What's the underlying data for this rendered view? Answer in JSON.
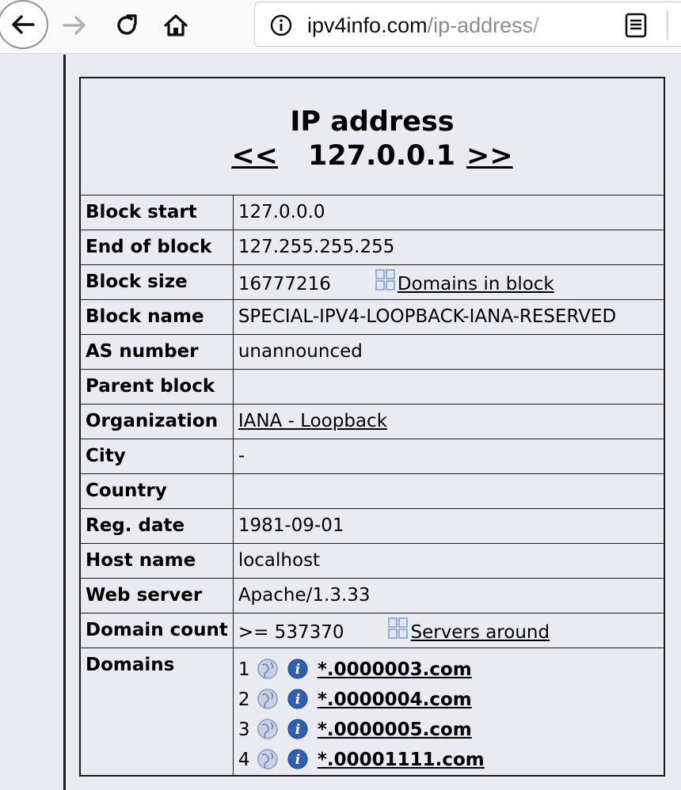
{
  "browser": {
    "url_host": "ipv4info.com",
    "url_path": "/ip-address/"
  },
  "header": {
    "title": "IP address",
    "prev": "<<",
    "ip": "127.0.0.1",
    "next": ">>"
  },
  "rows": {
    "block_start": {
      "label": "Block start",
      "value": "127.0.0.0"
    },
    "end_of_block": {
      "label": "End of block",
      "value": "127.255.255.255"
    },
    "block_size": {
      "label": "Block size",
      "value": "16777216",
      "link": "Domains in block"
    },
    "block_name": {
      "label": "Block name",
      "value": "SPECIAL-IPV4-LOOPBACK-IANA-RESERVED"
    },
    "as_number": {
      "label": "AS number",
      "value": "unannounced"
    },
    "parent_block": {
      "label": "Parent block",
      "value": ""
    },
    "organization": {
      "label": "Organization",
      "value": "IANA - Loopback"
    },
    "city": {
      "label": "City",
      "value": "-"
    },
    "country": {
      "label": "Country",
      "value": ""
    },
    "reg_date": {
      "label": "Reg. date",
      "value": "1981-09-01"
    },
    "host_name": {
      "label": "Host name",
      "value": "localhost"
    },
    "web_server": {
      "label": "Web server",
      "value": "Apache/1.3.33"
    },
    "domain_count": {
      "label": "Domain count",
      "value": ">= 537370",
      "link": "Servers around"
    },
    "domains": {
      "label": "Domains"
    }
  },
  "domains": [
    {
      "n": "1",
      "name": "*.0000003.com"
    },
    {
      "n": "2",
      "name": "*.0000004.com"
    },
    {
      "n": "3",
      "name": "*.0000005.com"
    },
    {
      "n": "4",
      "name": "*.00001111.com"
    }
  ],
  "colors": {
    "page_bg": "#e9ebf0",
    "border": "#1a1a1a",
    "globe_icon": "#9aa8c4",
    "info_icon": "#2f5fb0"
  }
}
